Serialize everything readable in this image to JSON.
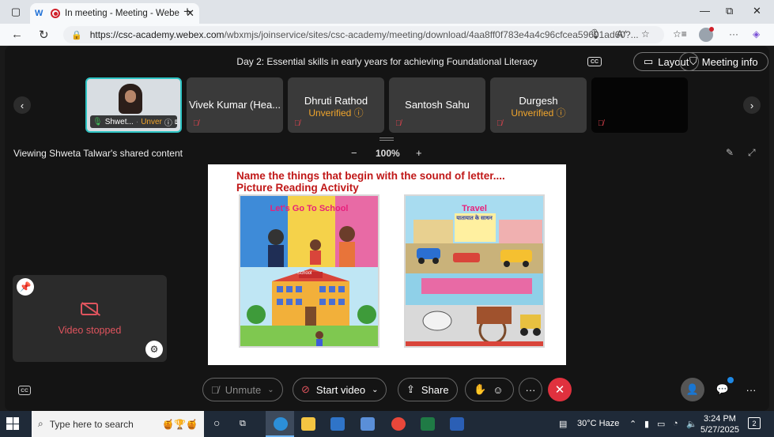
{
  "browser": {
    "tab_title": "In meeting - Meeting - Webe",
    "url_host": "https://csc-academy.webex.com",
    "url_path": "/wbxmjs/joinservice/sites/csc-academy/meeting/download/4aa8ff0f783e4a4c96cfcea59601ad60?..."
  },
  "meeting": {
    "title": "Day 2: Essential skills in early years for achieving Foundational Literacy",
    "layout_label": "Layout",
    "meeting_info_label": "Meeting info",
    "viewing_label": "Viewing Shweta Talwar's shared content",
    "zoom_level": "100%"
  },
  "participants": [
    {
      "name": "Shwet...",
      "status": "Unver",
      "self": true
    },
    {
      "name": "Vivek Kumar (Hea...",
      "status": ""
    },
    {
      "name": "Dhruti Rathod",
      "status": "Unverified"
    },
    {
      "name": "Santosh Sahu",
      "status": ""
    },
    {
      "name": "Durgesh",
      "status": "Unverified"
    },
    {
      "name": "",
      "status": ""
    }
  ],
  "slide": {
    "heading1": "Name the things that begin with the sound of letter....",
    "heading2": "Picture Reading Activity",
    "pic1_title": "Let's Go To School",
    "pic2_title": "Travel",
    "pic2_subtitle": "यातायात के साधन",
    "school_sign": "School"
  },
  "self_video": {
    "status": "Video stopped"
  },
  "controls": {
    "unmute": "Unmute",
    "start_video": "Start video",
    "share": "Share"
  },
  "taskbar": {
    "search_placeholder": "Type here to search",
    "weather": "30°C  Haze",
    "time": "3:24 PM",
    "date": "5/27/2025",
    "notifications": "2"
  },
  "colors": {
    "accent_teal": "#2ec4c4",
    "unverified_orange": "#f0a52c",
    "end_red": "#e0313e",
    "slide_heading_red": "#c01818"
  }
}
